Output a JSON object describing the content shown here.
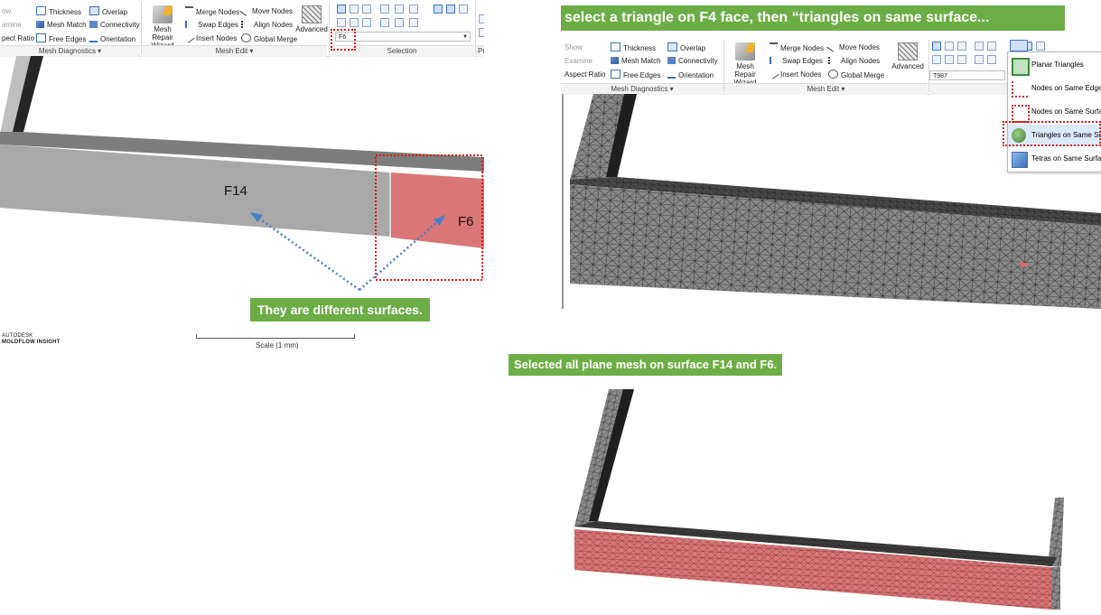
{
  "ribbon_left": {
    "mesh_diagnostics": {
      "group_label": "Mesh Diagnostics ▾",
      "items": [
        "ow",
        "amine",
        "pect Ratio",
        "Thickness",
        "Mesh Match",
        "Free Edges",
        "Overlap",
        "Connectivity",
        "Orientation"
      ]
    },
    "mesh_edit": {
      "group_label": "Mesh Edit ▾",
      "mesh_repair_wizard": "Mesh Repair Wizard",
      "items": [
        "Merge Nodes",
        "Swap Edges",
        "Insert Nodes",
        "Move Nodes",
        "Align Nodes",
        "Global Merge"
      ],
      "advanced": "Advanced"
    },
    "selection": {
      "group_label": "Selection",
      "entity_value": "F6"
    },
    "next_group_stub": "Pr"
  },
  "ribbon_right": {
    "mesh_diagnostics": {
      "group_label": "Mesh Diagnostics ▾",
      "items": [
        "Show",
        "Examine",
        "Aspect Ratio",
        "Thickness",
        "Mesh Match",
        "Free Edges",
        "Overlap",
        "Connectivity",
        "Orientation"
      ]
    },
    "mesh_edit": {
      "group_label": "Mesh Edit ▾",
      "mesh_repair_wizard": "Mesh Repair Wizard",
      "items": [
        "Merge Nodes",
        "Swap Edges",
        "Insert Nodes",
        "Move Nodes",
        "Align Nodes",
        "Global Merge"
      ],
      "advanced": "Advanced"
    },
    "selection": {
      "group_label": "Selec",
      "entity_value": "T987"
    }
  },
  "dropdown_menu": {
    "items": [
      "Planar Triangles",
      "Nodes on Same Edge",
      "Nodes on Same Surfa",
      "Triangles on Same Su",
      "Tetras on Same Surfac"
    ],
    "highlighted_index": 3
  },
  "annotations": {
    "top_right_instruction": "select a triangle on F4 face, then “triangles on same surface...",
    "different_surfaces": "They are different surfaces.",
    "selected_all": "Selected all plane mesh on surface F14 and F6.",
    "face_f14": "F14",
    "face_f6": "F6"
  },
  "brand": {
    "line1": "AUTODESK",
    "line2": "MOLDFLOW INSIGHT"
  },
  "scale_label": "Scale (1 mm)",
  "colors": {
    "green_label": "#6cae45",
    "selected_face": "#d97776",
    "gray_face": "#a8a8a8",
    "red_dash": "#e11818",
    "blue_arrow": "#4a7fc4"
  }
}
